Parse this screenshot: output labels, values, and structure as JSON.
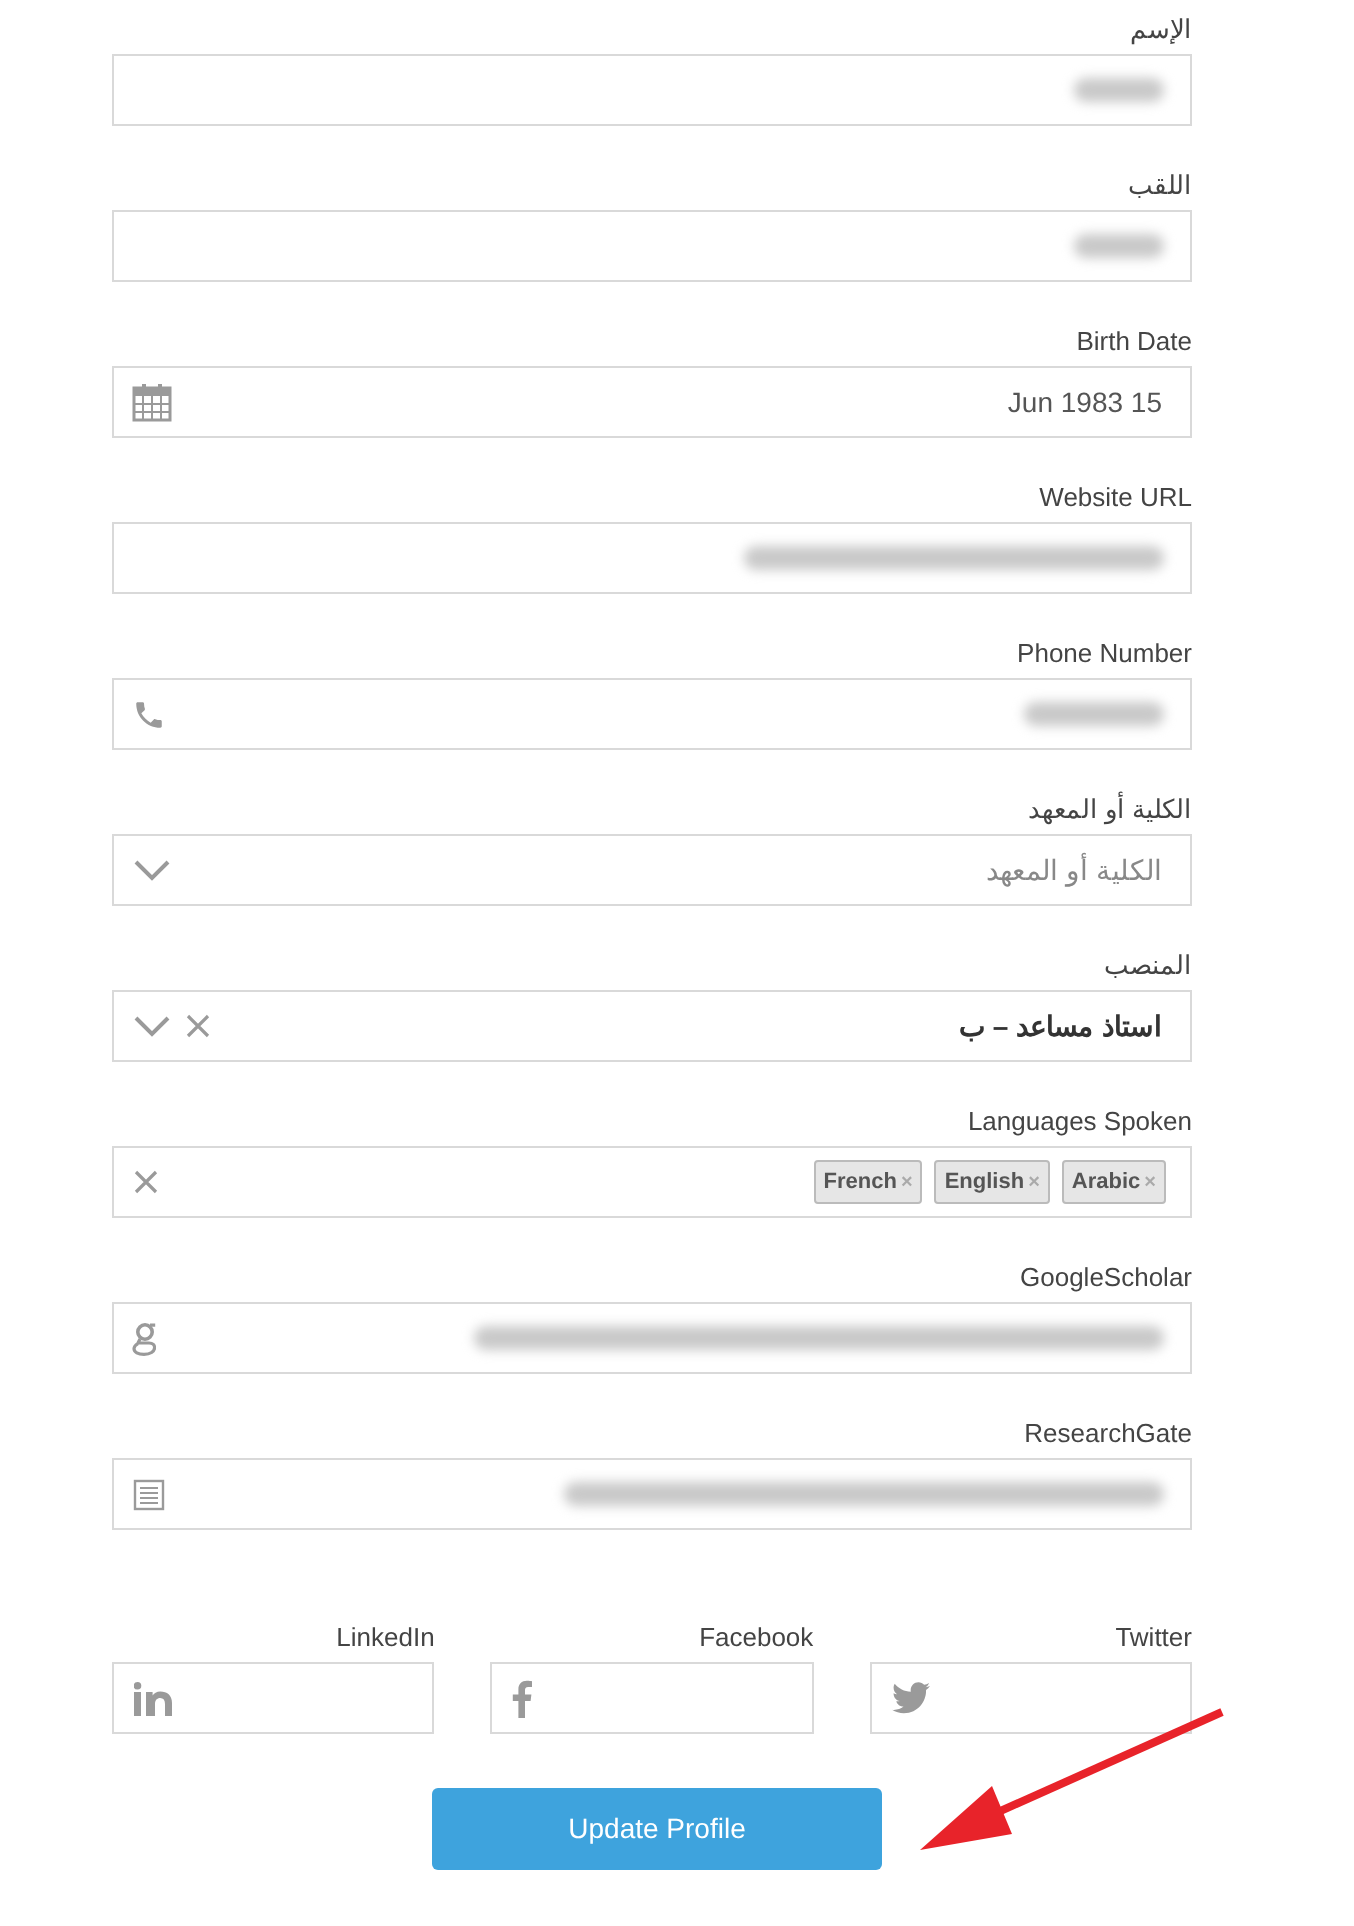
{
  "fields": [
    {
      "label": "الإسم",
      "kind": "text",
      "redacted": true
    },
    {
      "label": "اللقب",
      "kind": "text",
      "redacted": true
    },
    {
      "label": "Birth Date",
      "kind": "date",
      "value": "Jun 1983 15"
    },
    {
      "label": "Website URL",
      "kind": "url",
      "redacted": true
    },
    {
      "label": "Phone Number",
      "kind": "phone",
      "redacted": true
    },
    {
      "label": "الكلية أو المعهد",
      "kind": "select",
      "placeholder": "الكلية أو المعهد",
      "clearable": false
    },
    {
      "label": "المنصب",
      "kind": "select",
      "value": "استاذ مساعد – ب",
      "clearable": true
    },
    {
      "label": "Languages Spoken",
      "kind": "tags",
      "tags": [
        {
          "label": "French",
          "remove": "×"
        },
        {
          "label": "English",
          "remove": "×"
        },
        {
          "label": "Arabic",
          "remove": "×"
        }
      ]
    },
    {
      "label": "GoogleScholar",
      "kind": "scholar",
      "redacted": true
    },
    {
      "label": "ResearchGate",
      "kind": "researchgate",
      "redacted": true
    }
  ],
  "social": [
    {
      "label": "LinkedIn",
      "kind": "linkedin"
    },
    {
      "label": "Facebook",
      "kind": "facebook"
    },
    {
      "label": "Twitter",
      "kind": "twitter"
    }
  ],
  "submit": "Update Profile",
  "annotations": [
    {
      "kind": "arrow",
      "color": "#e8232a"
    }
  ]
}
